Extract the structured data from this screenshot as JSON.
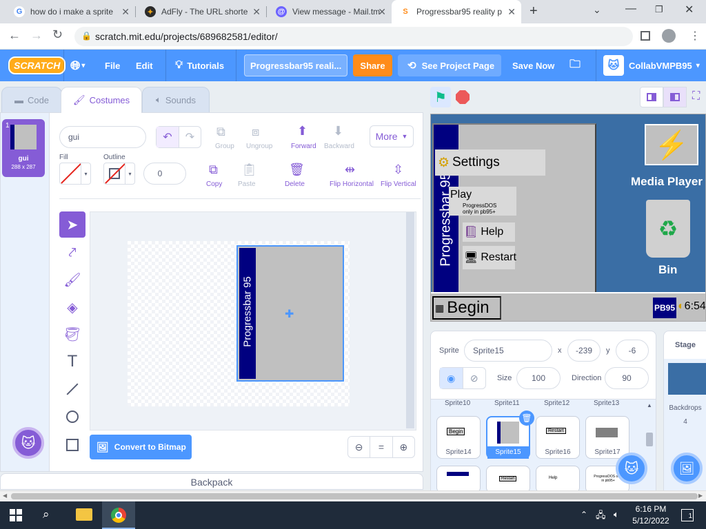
{
  "browser": {
    "tabs": [
      {
        "title": "how do i make a sprite",
        "favicon": "google-icon"
      },
      {
        "title": "AdFly - The URL shorte",
        "favicon": "adfly-icon"
      },
      {
        "title": "View message - Mail.tm",
        "favicon": "mail-icon"
      },
      {
        "title": "Progressbar95 reality p",
        "favicon": "scratch-icon",
        "active": true
      }
    ],
    "new_tab": "+",
    "url": "scratch.mit.edu/projects/689682581/editor/"
  },
  "menu": {
    "logo": "SCRATCH",
    "file": "File",
    "edit": "Edit",
    "tutorials": "Tutorials",
    "project_title": "Progressbar95 reali...",
    "share": "Share",
    "see_project": "See Project Page",
    "save_now": "Save Now",
    "username": "CollabVMPB95"
  },
  "editor_tabs": {
    "code": "Code",
    "costumes": "Costumes",
    "sounds": "Sounds"
  },
  "costume_list": [
    {
      "index": "1",
      "name": "gui",
      "size": "288 x 287"
    }
  ],
  "paint": {
    "costume_name": "gui",
    "group": "Group",
    "ungroup": "Ungroup",
    "forward": "Forward",
    "backward": "Backward",
    "more": "More",
    "fill_label": "Fill",
    "outline_label": "Outline",
    "outline_width": "0",
    "copy": "Copy",
    "paste": "Paste",
    "delete": "Delete",
    "flip_h": "Flip Horizontal",
    "flip_v": "Flip Vertical",
    "convert": "Convert to Bitmap",
    "zoom_reset": "=",
    "canvas_text": "Progressbar 95"
  },
  "backpack": "Backpack",
  "stage": {
    "settings": "Settings",
    "play": "Play",
    "progressdos": "ProgressDOS",
    "only_in": "only in pb95+",
    "help": "Help",
    "restart": "Restart",
    "side_text": "Progressbar 95",
    "begin": "Begin",
    "media_player": "Media Player",
    "bin": "Bin",
    "pb95": "PB95",
    "clock": "6:54"
  },
  "sprite_info": {
    "sprite_label": "Sprite",
    "sprite_name": "Sprite15",
    "x_label": "x",
    "x": "-239",
    "y_label": "y",
    "y": "-6",
    "size_label": "Size",
    "size": "100",
    "direction_label": "Direction",
    "direction": "90"
  },
  "sprites_top_row": [
    "Sprite10",
    "Sprite11",
    "Sprite12",
    "Sprite13"
  ],
  "sprites": [
    {
      "name": "Sprite14",
      "thumb": "Begin"
    },
    {
      "name": "Sprite15",
      "selected": true
    },
    {
      "name": "Sprite16",
      "thumb": "Restart"
    },
    {
      "name": "Sprite17"
    }
  ],
  "sprites_bottom_row": [
    {
      "thumb": ""
    },
    {
      "thumb": "Restart"
    },
    {
      "thumb": "Help"
    },
    {
      "thumb": "ProgressDOS only in pb95+"
    }
  ],
  "stage_panel": {
    "title": "Stage",
    "backdrops_label": "Backdrops",
    "backdrops": "4"
  },
  "taskbar": {
    "time": "6:16 PM",
    "date": "5/12/2022",
    "notif": "1"
  },
  "colors": {
    "scratch_blue": "#4c97ff",
    "purple": "#855cd6",
    "share_orange": "#ff8c1a",
    "pb_navy": "#000080"
  }
}
